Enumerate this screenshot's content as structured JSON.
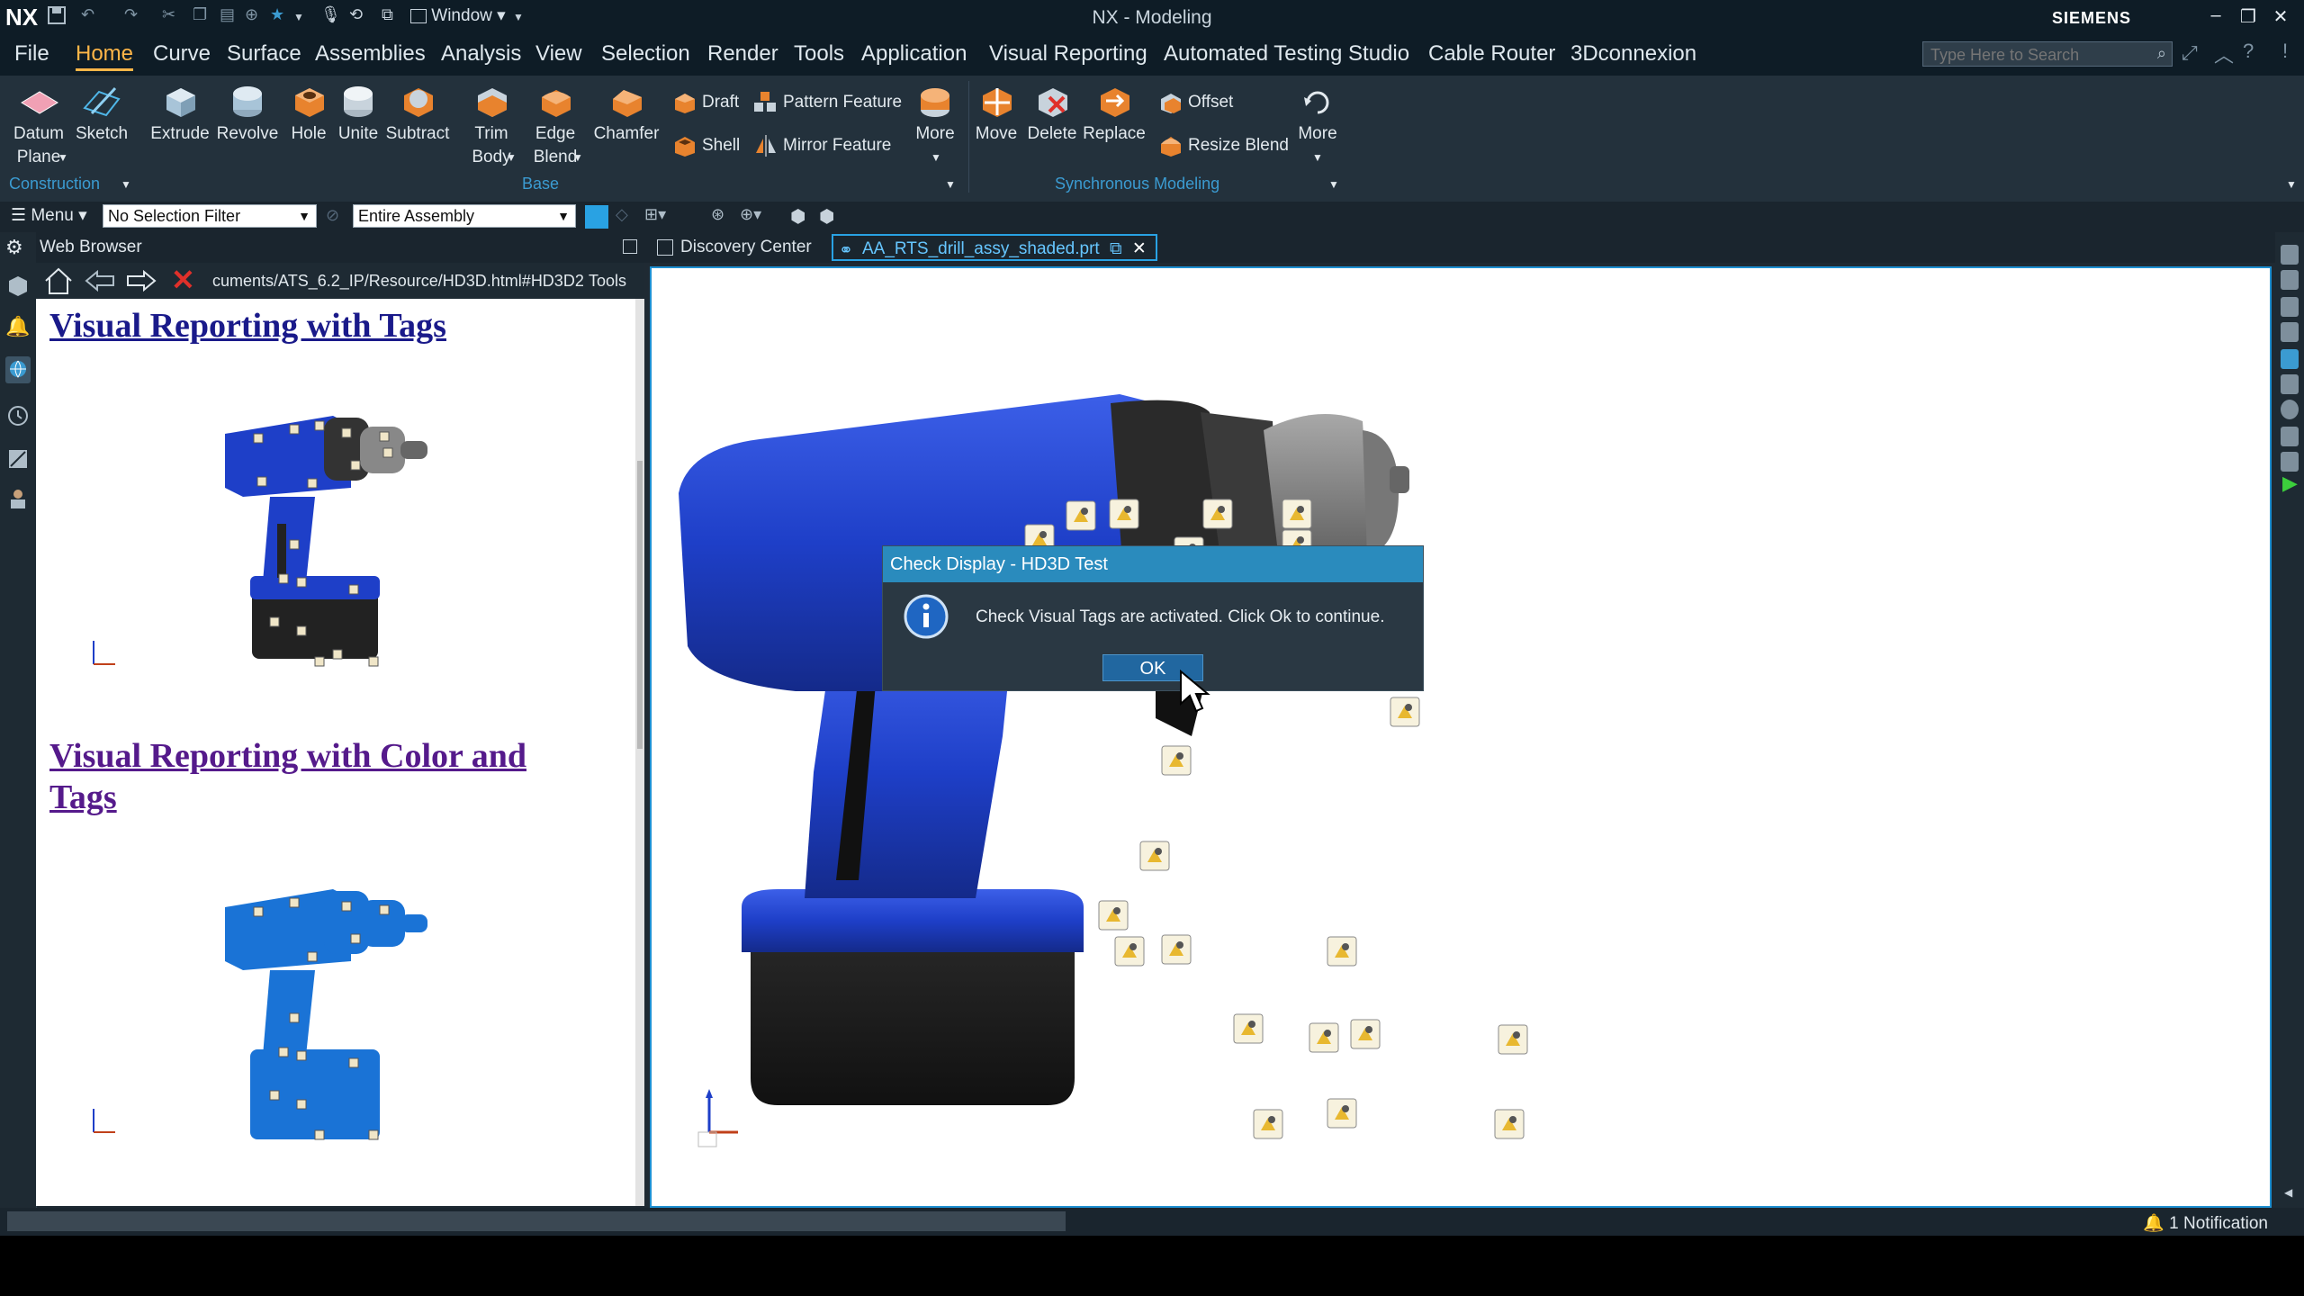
{
  "titlebar": {
    "brand": "NX",
    "window_menu": "Window",
    "title": "NX - Modeling",
    "company": "SIEMENS",
    "minimize": "–",
    "restore": "❐",
    "close": "✕"
  },
  "menubar": {
    "items": [
      "File",
      "Home",
      "Curve",
      "Surface",
      "Assemblies",
      "Analysis",
      "View",
      "Selection",
      "Render",
      "Tools",
      "Application",
      "Visual Reporting",
      "Automated Testing Studio",
      "Cable Router",
      "3Dconnexion"
    ],
    "active": "Home",
    "search_placeholder": "Type Here to Search"
  },
  "ribbon": {
    "datum_plane": "Datum\nPlane",
    "sketch": "Sketch",
    "extrude": "Extrude",
    "revolve": "Revolve",
    "hole": "Hole",
    "unite": "Unite",
    "subtract": "Subtract",
    "trim_body": "Trim\nBody",
    "edge_blend": "Edge\nBlend",
    "chamfer": "Chamfer",
    "draft": "Draft",
    "shell": "Shell",
    "pattern_feature": "Pattern Feature",
    "mirror_feature": "Mirror Feature",
    "more_base": "More",
    "move": "Move",
    "delete": "Delete",
    "replace": "Replace",
    "offset": "Offset",
    "resize_blend": "Resize Blend",
    "more_sync": "More",
    "group_construction": "Construction",
    "group_base": "Base",
    "group_sync": "Synchronous Modeling"
  },
  "filterbar": {
    "menu_label": "Menu",
    "selection_filter": "No Selection Filter",
    "scope": "Entire Assembly"
  },
  "webbrowser": {
    "title": "Web Browser",
    "url": "cuments/ATS_6.2_IP/Resource/HD3D.html#HD3D2",
    "tools": "Tools",
    "heading1": "Visual Reporting with Tags",
    "heading2_line1": "Visual Reporting with Color and",
    "heading2_line2": "Tags"
  },
  "tabs": {
    "discovery": "Discovery Center",
    "part": "AA_RTS_drill_assy_shaded.prt"
  },
  "dialog": {
    "title": "Check Display - HD3D Test",
    "message": "Check Visual Tags are activated. Click Ok to continue.",
    "ok": "OK"
  },
  "status": {
    "notification": "1 Notification"
  },
  "colors": {
    "accent": "#29a2e3",
    "active_menu": "#ffb648",
    "drill_blue": "#1e3fc8",
    "drill_blue_light": "#1a73d6",
    "dialog_title": "#2a8bbd"
  }
}
